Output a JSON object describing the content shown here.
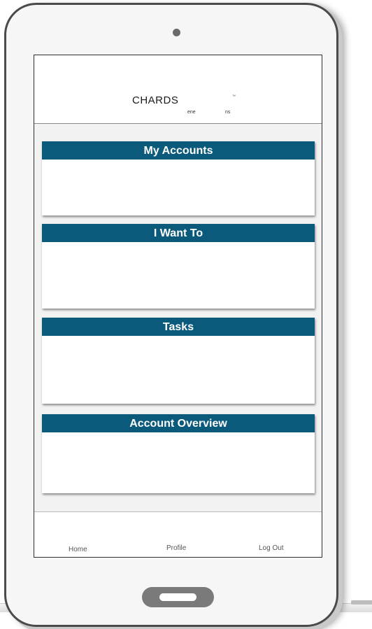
{
  "brand": {
    "logo_text": "CHARDS",
    "trademark": "™",
    "tagline_part1": "ene",
    "tagline_part2": "ns"
  },
  "cards": [
    {
      "title": "My Accounts"
    },
    {
      "title": "I Want To"
    },
    {
      "title": "Tasks"
    },
    {
      "title": "Account Overview"
    }
  ],
  "tabbar": {
    "home": "Home",
    "profile": "Profile",
    "logout": "Log Out"
  },
  "colors": {
    "card_header": "#0c5a7b",
    "screen_bg": "#f2f2f2",
    "device_frame": "#4a4a4a"
  }
}
